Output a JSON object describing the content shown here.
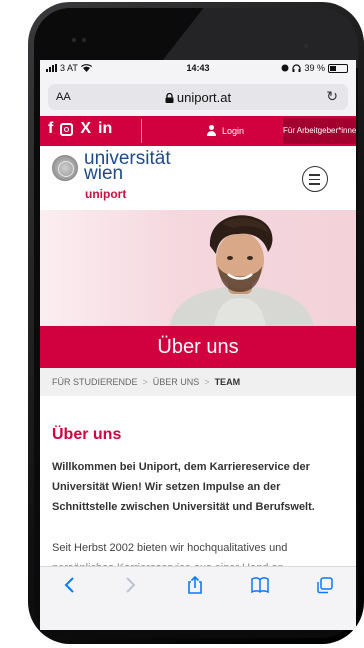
{
  "status_bar": {
    "carrier": "3 AT",
    "time": "14:43",
    "battery": "39 %",
    "battery_level": 0.39
  },
  "browser": {
    "text_size": "AA",
    "url": "uniport.at"
  },
  "site_header": {
    "login_label": "Login",
    "employer_label": "Für Arbeitgeber*innen"
  },
  "logo": {
    "university_line1": "universität",
    "university_line2": "wien",
    "uniport": "uniport"
  },
  "banner": {
    "title": "Über uns"
  },
  "breadcrumb": {
    "items": [
      "FÜR STUDIERENDE",
      "ÜBER UNS",
      "TEAM"
    ]
  },
  "content": {
    "heading": "Über uns",
    "intro": "Willkommen bei Uniport, dem Karriereservice der Universität Wien! Wir setzen Impulse an der Schnittstelle zwischen Universität und Berufswelt.",
    "paragraph": "Seit Herbst 2002 bieten wir hochqualitatives und",
    "paragraph_cut": "persönliches Karriereservice aus einer Hand an"
  },
  "colors": {
    "brand_red": "#d1003f",
    "brand_dark_red": "#a4002f",
    "uni_blue": "#1e4b8a",
    "ios_blue": "#0a7aff"
  }
}
